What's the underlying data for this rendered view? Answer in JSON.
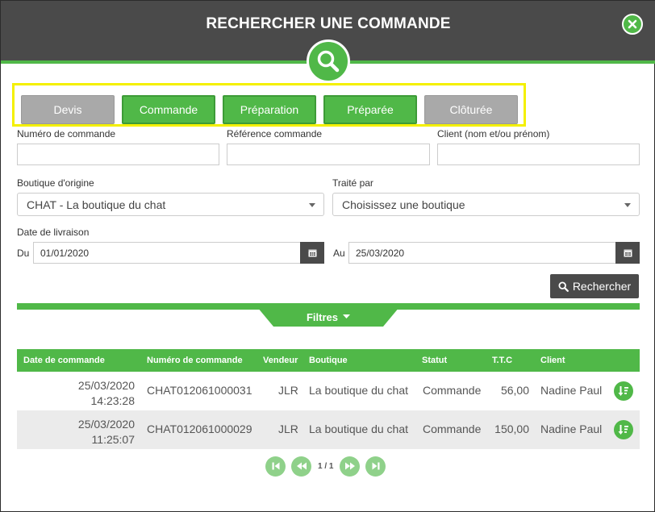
{
  "header": {
    "title": "RECHERCHER UNE COMMANDE"
  },
  "status_buttons": [
    {
      "label": "Devis",
      "state": "inactive"
    },
    {
      "label": "Commande",
      "state": "active"
    },
    {
      "label": "Préparation",
      "state": "active"
    },
    {
      "label": "Préparée",
      "state": "active"
    },
    {
      "label": "Clôturée",
      "state": "inactive"
    }
  ],
  "form": {
    "order_number_label": "Numéro de commande",
    "order_number_value": "",
    "order_ref_label": "Référence commande",
    "order_ref_value": "",
    "client_label": "Client (nom et/ou prénom)",
    "client_value": "",
    "origin_shop_label": "Boutique d'origine",
    "origin_shop_value": "CHAT - La boutique du chat",
    "handled_by_label": "Traité par",
    "handled_by_value": "Choisissez une boutique",
    "delivery_date_label": "Date de livraison",
    "from_label": "Du",
    "from_value": "01/01/2020",
    "to_label": "Au",
    "to_value": "25/03/2020",
    "search_button_label": "Rechercher",
    "filters_label": "Filtres"
  },
  "table": {
    "columns": [
      "Date de commande",
      "Numéro de commande",
      "Vendeur",
      "Boutique",
      "Statut",
      "T.T.C",
      "Client"
    ],
    "rows": [
      {
        "date": "25/03/2020",
        "time": "14:23:28",
        "number": "CHAT012061000031",
        "seller": "JLR",
        "shop": "La boutique du chat",
        "status": "Commande",
        "ttc": "56,00",
        "client": "Nadine Paul"
      },
      {
        "date": "25/03/2020",
        "time": "11:25:07",
        "number": "CHAT012061000029",
        "seller": "JLR",
        "shop": "La boutique du chat",
        "status": "Commande",
        "ttc": "150,00",
        "client": "Nadine Paul"
      }
    ]
  },
  "pagination": {
    "text": "1 / 1"
  },
  "colors": {
    "accent": "#50b848",
    "header": "#4a4a4a",
    "inactive": "#a9a9a9",
    "highlight_border": "#f4f000"
  }
}
